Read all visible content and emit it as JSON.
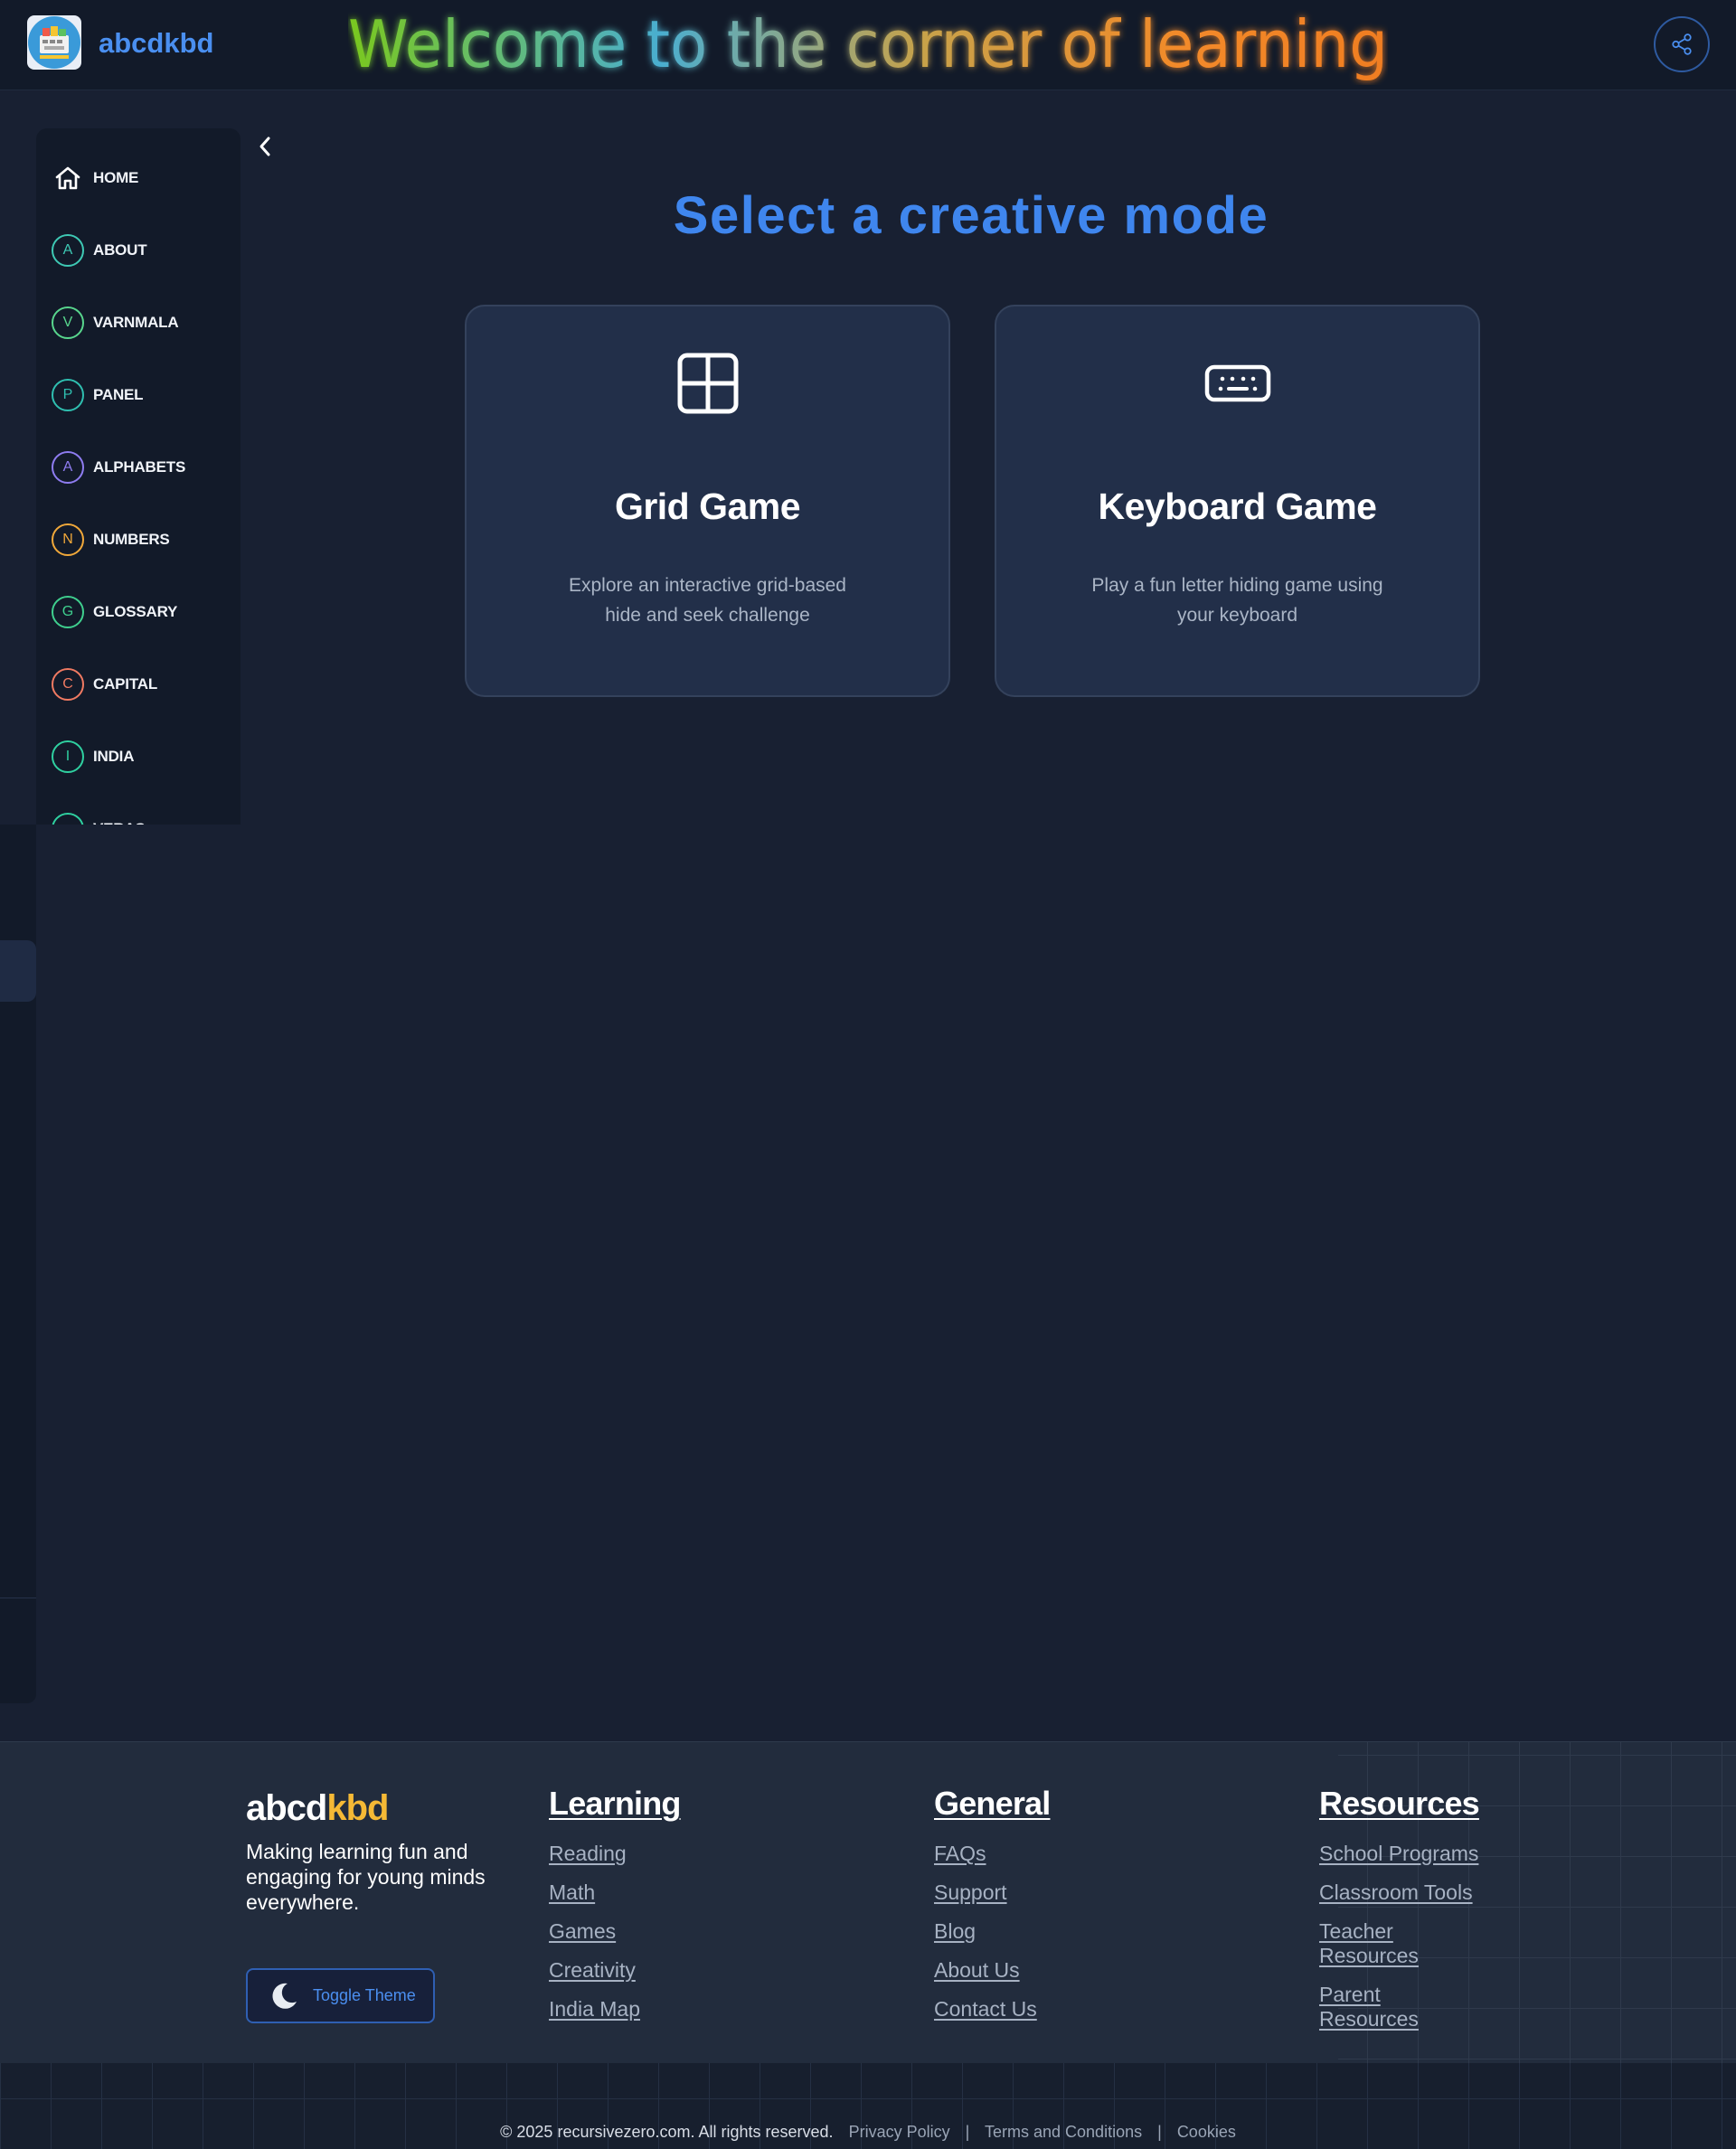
{
  "header": {
    "brand": "abcdkbd",
    "welcome": "Welcome to the corner of learning",
    "welcome_gradient": [
      "#7ac81e",
      "#4aaed0",
      "#c7a24a",
      "#f28a2a",
      "#f07d22"
    ]
  },
  "sidebar": {
    "items": [
      {
        "letter": "",
        "label": "HOME",
        "color": "#ffffff"
      },
      {
        "letter": "A",
        "label": "ABOUT",
        "color": "#3ec9b4"
      },
      {
        "letter": "V",
        "label": "VARNMALA",
        "color": "#58d68d"
      },
      {
        "letter": "P",
        "label": "PANEL",
        "color": "#2fbfb0"
      },
      {
        "letter": "A",
        "label": "ALPHABETS",
        "color": "#8e7cf0"
      },
      {
        "letter": "N",
        "label": "NUMBERS",
        "color": "#f0a83a"
      },
      {
        "letter": "G",
        "label": "GLOSSARY",
        "color": "#3fcf8e"
      },
      {
        "letter": "C",
        "label": "CAPITAL",
        "color": "#f07a62"
      },
      {
        "letter": "I",
        "label": "INDIA",
        "color": "#2fd0a0"
      },
      {
        "letter": "",
        "label": "VERAS",
        "color": "#2fd0a0"
      }
    ]
  },
  "main": {
    "title": "Select a creative mode",
    "cards": [
      {
        "title": "Grid Game",
        "description": "Explore an interactive grid-based hide and seek challenge",
        "icon": "grid-icon"
      },
      {
        "title": "Keyboard Game",
        "description": "Play a fun letter hiding game using your keyboard",
        "icon": "keyboard-icon"
      }
    ]
  },
  "footer": {
    "brand_a": "abcd",
    "brand_b": "kbd",
    "tagline": "Making learning fun and engaging for young minds everywhere.",
    "theme_button": "Toggle Theme",
    "columns": [
      {
        "title": "Learning",
        "links": [
          "Reading",
          "Math",
          "Games",
          "Creativity",
          "India Map"
        ]
      },
      {
        "title": "General",
        "links": [
          "FAQs",
          "Support",
          "Blog",
          "About Us",
          "Contact Us"
        ]
      },
      {
        "title": "Resources",
        "links": [
          "School Programs",
          "Classroom Tools",
          "Teacher Resources",
          "Parent Resources"
        ]
      }
    ],
    "copyright": "© 2025 recursivezero.com. All rights reserved.",
    "legal": [
      "Privacy Policy",
      "Terms and Conditions",
      "Cookies"
    ]
  }
}
